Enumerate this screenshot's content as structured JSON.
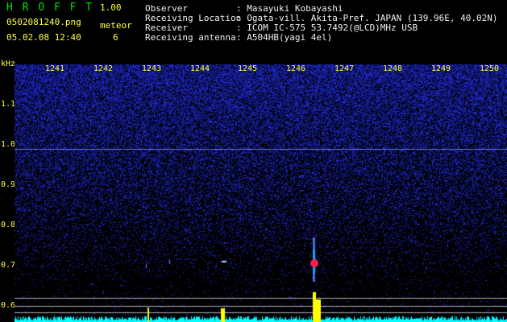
{
  "header": {
    "app_name": "H R O F F T",
    "version": "1.00",
    "filename": "0502081240.png",
    "meteor_label": "meteor",
    "datetime": "05.02.08 12:40",
    "meteor_count": "6"
  },
  "info": {
    "labels": [
      "Observer",
      "Receiving Location",
      "Receiver",
      "Receiving antenna"
    ],
    "values": [
      ": Masayuki Kobayashi",
      ": Ogata-vill. Akita-Pref. JAPAN (139.96E, 40.02N)",
      ": ICOM IC-575 53.7492(@LCD)MHz USB",
      ": A504HB(yagi 4el)"
    ]
  },
  "axis": {
    "unit": "kHz",
    "y_ticks": [
      "1.1",
      "1.0",
      "0.9",
      "0.8",
      "0.7",
      "0.6"
    ],
    "time_ticks": [
      "1241",
      "1242",
      "1243",
      "1244",
      "1245",
      "1246",
      "1247",
      "1248",
      "1249",
      "1250"
    ]
  },
  "colors": {
    "background": "#000000",
    "noise": "#1020a0",
    "trace": "#00ffff",
    "echo_peak": "#ff2050",
    "echo_yellow": "#ffff00"
  }
}
